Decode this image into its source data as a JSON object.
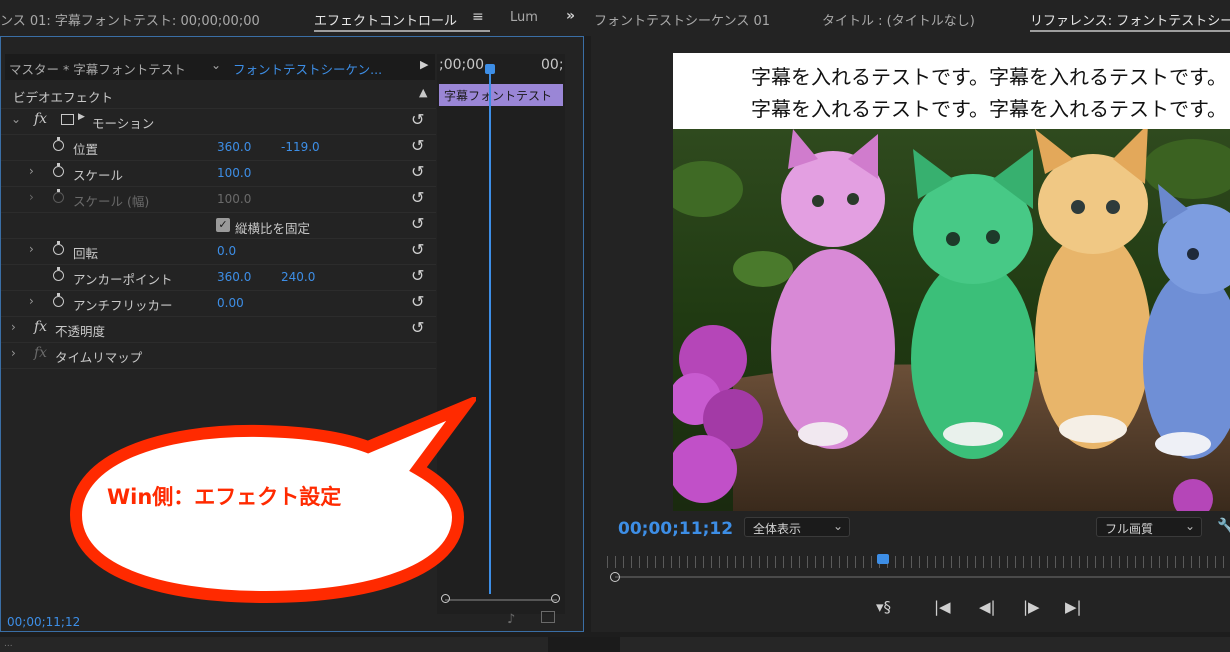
{
  "tabs": {
    "left_1": "ンス 01: 字幕フォントテスト: 00;00;00;00",
    "left_2": "エフェクトコントロール",
    "left_3": "Lum",
    "right_1": "フォントテストシーケンス 01",
    "right_2": "タイトル : (タイトルなし)",
    "right_3": "リファレンス: フォントテストシーケ"
  },
  "effect_controls": {
    "master_label": "マスター * 字幕フォントテスト",
    "sequence_label": "フォントテストシーケン...",
    "ruler_start": ";00;00",
    "ruler_end": "00;",
    "clip_label": "字幕フォントテスト",
    "section_video": "ビデオエフェクト",
    "motion": "モーション",
    "position_label": "位置",
    "position_x": "360.0",
    "position_y": "-119.0",
    "scale_label": "スケール",
    "scale_value": "100.0",
    "scale_width_label": "スケール (幅)",
    "scale_width_value": "100.0",
    "uniform_scale_label": "縦横比を固定",
    "rotation_label": "回転",
    "rotation_value": "0.0",
    "anchor_label": "アンカーポイント",
    "anchor_x": "360.0",
    "anchor_y": "240.0",
    "flicker_label": "アンチフリッカー",
    "flicker_value": "0.00",
    "opacity_label": "不透明度",
    "timeremap_label": "タイムリマップ",
    "timecode": "00;00;11;12"
  },
  "callout": {
    "text": "Win側：エフェクト設定"
  },
  "program": {
    "subtitle_line1": "字幕を入れるテストです。字幕を入れるテストです。",
    "subtitle_line2": "字幕を入れるテストです。字幕を入れるテストです。",
    "timecode": "00;00;11;12",
    "zoom": "全体表示",
    "quality": "フル画質"
  },
  "bottom_strip": {
    "left_text": "..."
  },
  "icons": [
    "menu-icon",
    "more-panels-icon",
    "play-icon",
    "reset-icon",
    "stopwatch-icon",
    "chevron-right-icon",
    "wrench-icon",
    "marker-icon",
    "step-back-icon",
    "step-forward-icon",
    "go-in-icon",
    "go-out-icon"
  ],
  "colors": {
    "accent": "#3d8ee6",
    "clip": "#9a86d6",
    "callout": "#ff2a00",
    "callout_text": "#ff2a00"
  }
}
